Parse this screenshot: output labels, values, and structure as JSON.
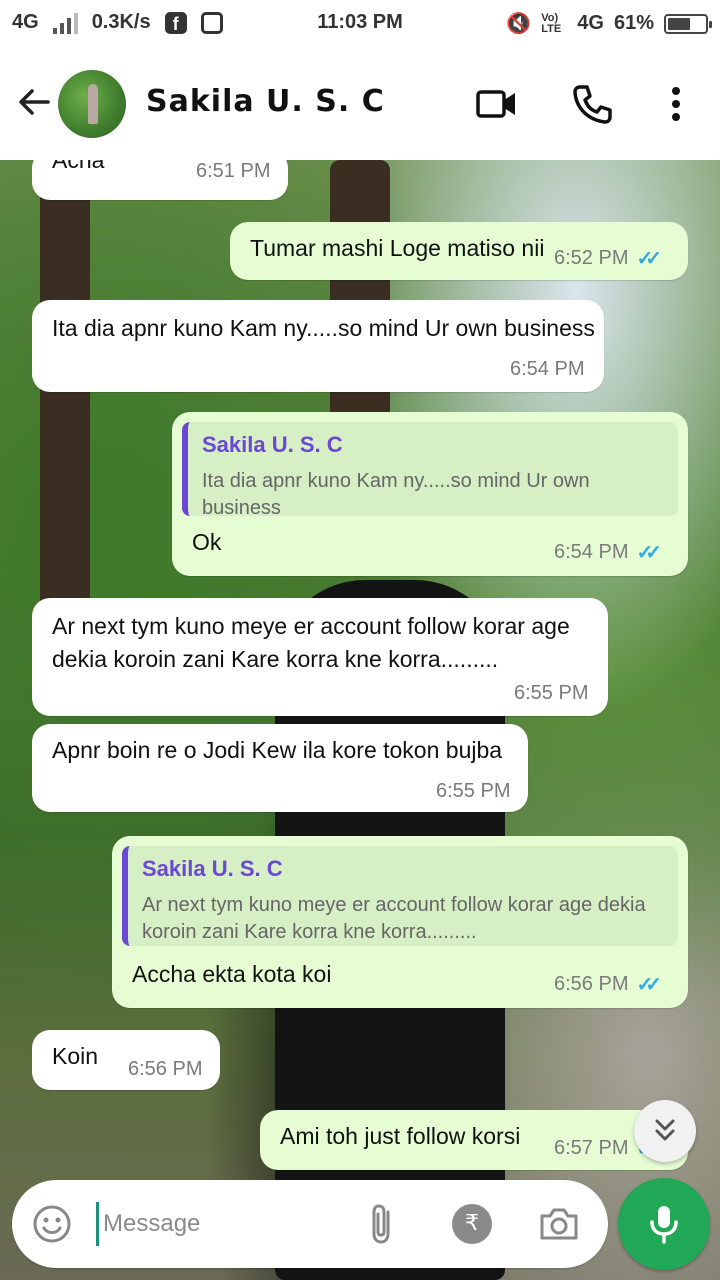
{
  "status_bar": {
    "network": "4G",
    "speed": "0.3K/s",
    "time": "11:03 PM",
    "volte": "Vo) LTE",
    "network2": "4G",
    "battery": "61%",
    "battery_level": 0.61
  },
  "header": {
    "contact_name": "Sakila U. S. C"
  },
  "messages": [
    {
      "dir": "in",
      "text": "Acha",
      "time": "6:51 PM"
    },
    {
      "dir": "out",
      "text": "Tumar mashi Loge matiso nii",
      "time": "6:52 PM"
    },
    {
      "dir": "in",
      "text": "Ita dia apnr kuno Kam ny.....so mind Ur own business",
      "time": "6:54 PM"
    },
    {
      "dir": "out",
      "quote_name": "Sakila U. S. C",
      "quote_text": "Ita dia apnr kuno Kam ny.....so mind Ur own business",
      "text": "Ok",
      "time": "6:54 PM"
    },
    {
      "dir": "in",
      "text": "Ar next tym kuno meye er account follow korar age dekia koroin zani Kare korra kne korra.........",
      "time": "6:55 PM"
    },
    {
      "dir": "in",
      "text": "Apnr boin re o Jodi Kew ila kore tokon bujba",
      "time": "6:55 PM"
    },
    {
      "dir": "out",
      "quote_name": "Sakila U. S. C",
      "quote_text": "Ar next tym kuno meye er account follow korar age dekia koroin zani Kare korra kne korra.........",
      "text": "Accha ekta kota koi",
      "time": "6:56 PM"
    },
    {
      "dir": "in",
      "text": "Koin",
      "time": "6:56 PM"
    },
    {
      "dir": "out",
      "text": "Ami toh just follow korsi",
      "time": "6:57 PM"
    }
  ],
  "composer": {
    "placeholder": "Message",
    "rupee_symbol": "₹"
  },
  "colors": {
    "outgoing_bubble": "#e6fdd4",
    "incoming_bubble": "#ffffff",
    "read_ticks": "#34a8e0",
    "accent": "#20a856",
    "quote_bar": "#6b47d6"
  }
}
